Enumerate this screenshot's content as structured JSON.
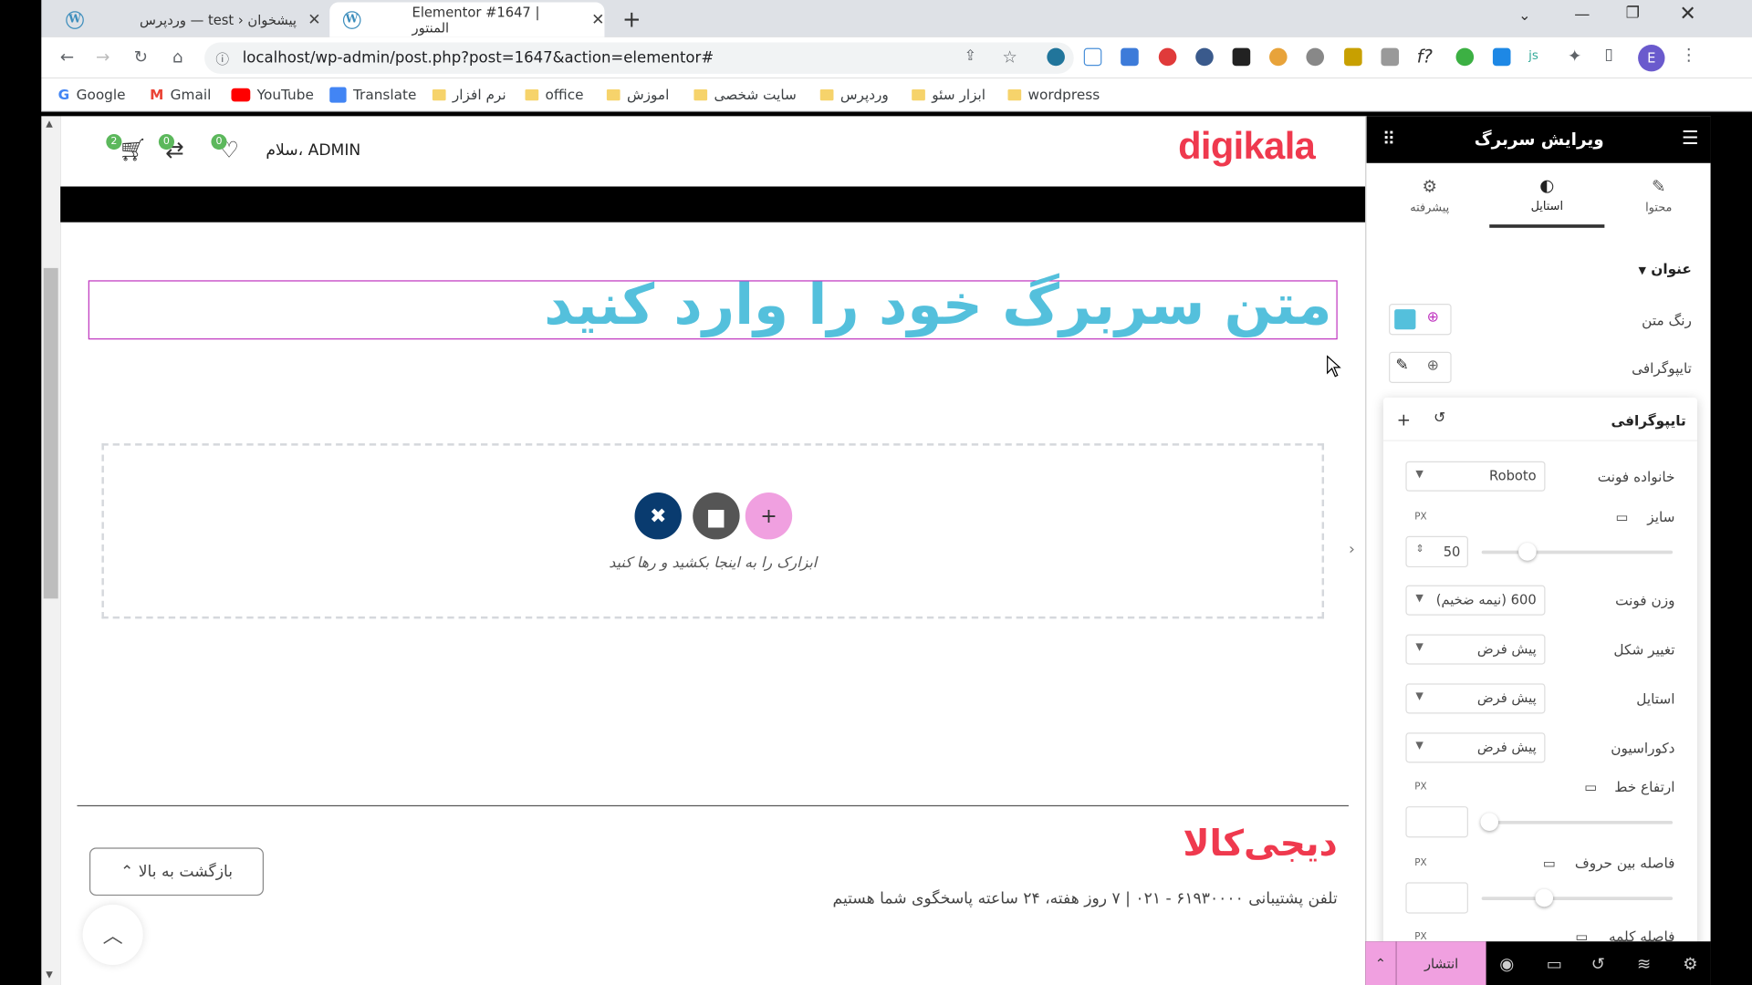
{
  "browser": {
    "tabs": [
      {
        "title": "پیشخوان ‹ test — وردپرس",
        "close": "✕"
      },
      {
        "title": "Elementor #1647 | المنتور",
        "close": "✕"
      }
    ],
    "new_tab": "+",
    "url": "localhost/wp-admin/post.php?post=1647&action=elementor#",
    "profile_initial": "E",
    "bookmarks": [
      "Google",
      "Gmail",
      "YouTube",
      "Translate",
      "نرم افزار",
      "office",
      "اموزش",
      "سایت شخصی",
      "وردپرس",
      "ابزار سئو",
      "wordpress"
    ]
  },
  "site": {
    "logo": "digikala",
    "greeting": "سلام، ADMIN",
    "cart_count": "2",
    "compare_count": "0",
    "wishlist_count": "0"
  },
  "canvas": {
    "heading_text": "متن سربرگ خود را وارد کنید",
    "drop_label": "ابزارک را به اینجا بکشید و رها کنید",
    "footer_logo": "دیجی‌کالا",
    "support_text": "تلفن پشتیبانی ۶۱۹۳۰۰۰۰ - ۰۲۱  |  ۷ روز هفته، ۲۴ ساعته پاسخگوی شما هستیم",
    "back_to_top": "بازگشت به بالا ⌃"
  },
  "panel": {
    "title": "ویرایش سربرگ",
    "tabs": [
      "محتوا",
      "استایل",
      "پیشرفته"
    ],
    "active_tab": "استایل",
    "section": "عنوان",
    "text_color_label": "رنگ متن",
    "text_color": "#54c0dc",
    "typography_label": "تایپوگرافی",
    "popover_title": "تایپوگرافی",
    "font_family_label": "خانواده فونت",
    "font_family": "Roboto",
    "size_label": "سایز",
    "size_unit": "PX",
    "size_value": "50",
    "size_slider": 0.24,
    "weight_label": "وزن فونت",
    "weight": "600 (نیمه ضخیم)",
    "transform_label": "تغییر شکل",
    "transform": "پیش فرض",
    "style_label": "استایل",
    "style": "پیش فرض",
    "decoration_label": "دکوراسیون",
    "decoration": "پیش فرض",
    "line_height_label": "ارتفاع خط",
    "line_height_unit": "PX",
    "letter_spacing_label": "فاصله بین حروف",
    "letter_spacing_unit": "PX",
    "letter_spacing_slider": 0.33,
    "word_spacing_label": "فاصله کلمه",
    "word_spacing_unit": "PX",
    "publish": "انتشار"
  },
  "colors": {
    "accent": "#54c0dc",
    "brand": "#ef394e",
    "publish_bg": "#f0a0e0"
  }
}
